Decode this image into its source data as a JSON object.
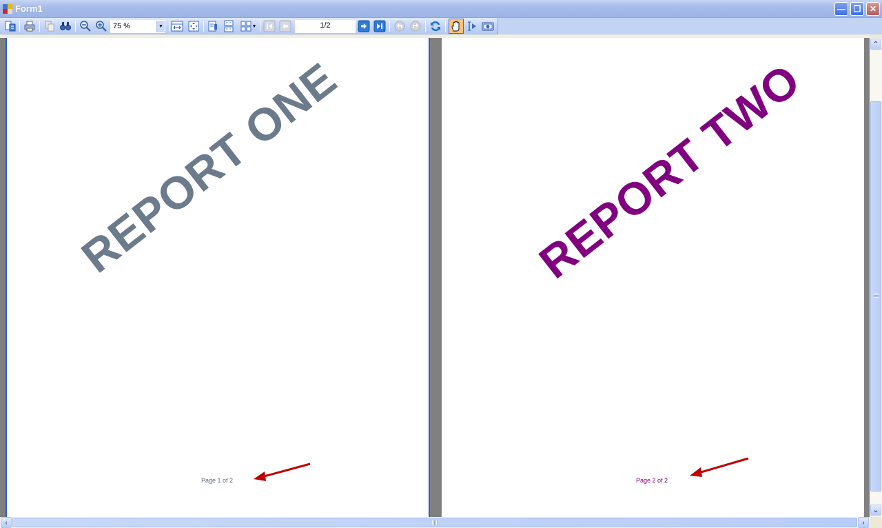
{
  "window": {
    "title": "Form1",
    "controls": {
      "minimize": "minimize",
      "restore": "restore",
      "close": "close"
    }
  },
  "toolbar": {
    "buttons": [
      {
        "icon": "document-map-icon",
        "label": "Document Map"
      },
      {
        "icon": "print-icon",
        "label": "Print"
      },
      {
        "icon": "copy-icon",
        "label": "Copy",
        "enabled": false
      },
      {
        "icon": "find-icon",
        "label": "Find"
      },
      {
        "icon": "zoom-out-icon",
        "label": "Zoom Out"
      },
      {
        "icon": "zoom-in-icon",
        "label": "Zoom In"
      },
      {
        "icon": "page-width-icon",
        "label": "Page Width"
      },
      {
        "icon": "whole-page-icon",
        "label": "Whole Page"
      },
      {
        "icon": "single-page-icon",
        "label": "Single Page"
      },
      {
        "icon": "continuous-icon",
        "label": "Continuous"
      },
      {
        "icon": "multiple-pages-icon",
        "label": "Multiple Pages"
      },
      {
        "icon": "first-page-icon",
        "label": "First Page",
        "enabled": false
      },
      {
        "icon": "previous-page-icon",
        "label": "Previous Page",
        "enabled": false
      },
      {
        "icon": "next-page-icon",
        "label": "Next Page"
      },
      {
        "icon": "last-page-icon",
        "label": "Last Page"
      },
      {
        "icon": "back-icon",
        "label": "Back",
        "enabled": false
      },
      {
        "icon": "forward-icon",
        "label": "Forward",
        "enabled": false
      },
      {
        "icon": "refresh-icon",
        "label": "Refresh"
      },
      {
        "icon": "hand-tool-icon",
        "label": "Hand Tool",
        "active": true
      },
      {
        "icon": "select-text-icon",
        "label": "Select"
      },
      {
        "icon": "snapshot-icon",
        "label": "Snapshot"
      }
    ],
    "zoom_value": "75 %",
    "page_indicator": "1/2"
  },
  "pages": [
    {
      "watermark": "REPORT ONE",
      "watermark_color": "#6b7b8b",
      "footer": "Page 1 of 2",
      "footer_color": "#5d6b7b",
      "selected": true
    },
    {
      "watermark": "REPORT TWO",
      "watermark_color": "#800080",
      "footer": "Page 2 of 2",
      "footer_color": "#800080",
      "selected": false
    }
  ],
  "annotations": {
    "arrow_color": "#c00000"
  },
  "scrollbars": {
    "vertical_position": "top",
    "horizontal_position": "left"
  }
}
